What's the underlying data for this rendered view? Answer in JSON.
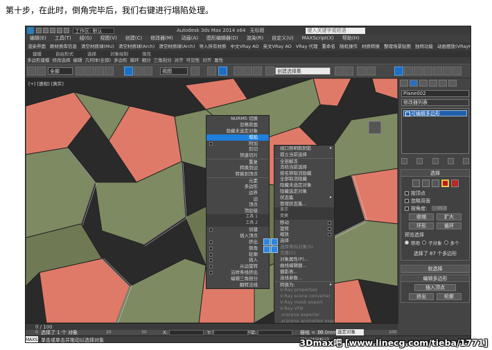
{
  "caption": "第十步，在此时，倒角完毕后，我们右键进行塌陷处理。",
  "titlebar": {
    "workspace": "工作区: 默认",
    "title": "Autodesk 3ds Max 2014 x64",
    "doc": "无标题",
    "search_placeholder": "键入关键字或短语"
  },
  "menus": [
    "编辑(E)",
    "工具(T)",
    "组(G)",
    "视图(V)",
    "创建(C)",
    "修改器(M)",
    "动画(A)",
    "图形编辑器(D)",
    "渲染(R)",
    "自定义(U)",
    "MAXScript(X)",
    "帮助(H)"
  ],
  "menus2": [
    "渲染界面",
    "刷材质库信息",
    "清空材质球(MU)",
    "清空材质球(Arch)",
    "清空材质球(Arch)",
    "导入所有材质",
    "中文VRay AO",
    "英文VRay AO",
    "VRay 代理",
    "重命名",
    "随机操作",
    "材质转换",
    "整理场景贴图",
    "独特功能",
    "动画摆放(VRayHM)"
  ],
  "ribbon_tabs": [
    "建模",
    "自由形式",
    "选择",
    "对象绘制",
    "填充"
  ],
  "ribbon_row": [
    "多边形建模",
    "修改选择",
    "编辑",
    "几何体(全部)",
    "多边形",
    "循环",
    "细分",
    "三角剖分",
    "对齐",
    "可见性",
    "对齐",
    "属性"
  ],
  "toolbar": {
    "filter": "全部",
    "view": "视图",
    "named_sel": "创建选择集"
  },
  "viewport": {
    "label": "[+] [透视] [真实]"
  },
  "quad_left": [
    {
      "text": "NURMS 切换",
      "dim": false
    },
    {
      "text": "忽略背面",
      "dim": false
    },
    {
      "text": "隐藏未选定对象",
      "dim": false
    },
    {
      "text": "塌陷",
      "hl": true,
      "box": false
    },
    {
      "text": "附加",
      "box": true
    },
    {
      "text": "剪切",
      "dim": false
    },
    {
      "text": "快速切片",
      "dim": false
    },
    {
      "text": "重复",
      "sep": true
    },
    {
      "text": "转换到边",
      "dim": false
    },
    {
      "text": "转换到顶点",
      "dim": false
    },
    {
      "text": "元素",
      "sep": true
    },
    {
      "text": "多边形",
      "dim": false
    },
    {
      "text": "边界",
      "dim": false
    },
    {
      "text": "边",
      "dim": false
    },
    {
      "text": "顶点",
      "dim": false
    },
    {
      "text": "顶层级",
      "dim": false
    },
    {
      "text": "工具 1",
      "title": true
    },
    {
      "text": "工具 2",
      "title": true
    },
    {
      "text": "创建",
      "box": true
    },
    {
      "text": "插入顶点",
      "dim": false
    },
    {
      "text": "挤出",
      "box": true
    },
    {
      "text": "倒角",
      "box": true
    },
    {
      "text": "轮廓",
      "box": true
    },
    {
      "text": "插入",
      "box": true
    },
    {
      "text": "从边旋转",
      "box": true
    },
    {
      "text": "沿样条线挤出",
      "box": true
    },
    {
      "text": "编辑三角剖分",
      "dim": false
    },
    {
      "text": "翻转法线",
      "dim": false
    }
  ],
  "quad_right": [
    {
      "text": "视口照明和阴影",
      "arrow": true
    },
    {
      "text": "孤立当前选择"
    },
    {
      "text": "全部解冻",
      "sep": true
    },
    {
      "text": "冻结当前选择"
    },
    {
      "text": "按名称取消隐藏"
    },
    {
      "text": "全部取消隐藏"
    },
    {
      "text": "隐藏未选定对象"
    },
    {
      "text": "隐藏选定对象"
    },
    {
      "text": "状态集",
      "arrow": true
    },
    {
      "text": "管理状态集..."
    },
    {
      "text": "显示",
      "title": true
    },
    {
      "text": "变换",
      "title": true
    },
    {
      "text": "移动",
      "box": true
    },
    {
      "text": "旋转",
      "box": true
    },
    {
      "text": "缩放",
      "box": true
    },
    {
      "text": "选择"
    },
    {
      "text": "选择类似对象(S)",
      "dim": true
    },
    {
      "text": "克隆(C)",
      "dim": true
    },
    {
      "text": "对象属性(P)..."
    },
    {
      "text": "曲线编辑器..."
    },
    {
      "text": "摄影表..."
    },
    {
      "text": "连线参数..."
    },
    {
      "text": "转换为:",
      "arrow": true,
      "sep": true
    },
    {
      "text": "V-Ray properties",
      "dim": true
    },
    {
      "text": "V-Ray scene converter",
      "dim": true
    },
    {
      "text": "V-Ray mesh export",
      "dim": true
    },
    {
      "text": "V-Ray VFB",
      "dim": true
    },
    {
      "text": ".vrscene exporter",
      "dim": true
    },
    {
      "text": ".vrscene animation exporter",
      "dim": true
    }
  ],
  "cmdpanel": {
    "object_name": "Plane002",
    "modifier_list": "修改器列表",
    "stack_item": "可编辑多边形",
    "selection_title": "选择",
    "by_vertex": "按顶点",
    "ignore_back": "忽略背面",
    "by_angle": "按角度:",
    "angle_value": "45.0",
    "shrink": "收缩",
    "grow": "扩大",
    "ring": "环形",
    "loop": "循环",
    "preview_title": "预览选择",
    "off": "禁用",
    "subobj": "子对象",
    "multi": "多个",
    "status": "选择了 87 个多边形",
    "soft_title": "软选择",
    "edit_poly_title": "编辑多边形",
    "insert_vertex": "插入顶点",
    "extrude": "挤出",
    "outline": "轮廓"
  },
  "timeline": {
    "frame": "0 / 100",
    "ticks": [
      "0",
      "10",
      "20",
      "30",
      "40",
      "50",
      "60",
      "70",
      "80",
      "90",
      "100"
    ]
  },
  "status": {
    "maxscript": "MAXS.m",
    "line1": "选择了 1 个 对象",
    "line2": "单击或单击并拖动以选择对象",
    "x_label": "X:",
    "y_label": "Y:",
    "z_label": "Z:",
    "grid": "栅格 = 10.0mm",
    "add_tag": "添加时间标记",
    "select_dd": "选定对象"
  },
  "watermark": "3Dmax吧  [www.linecg.com/tieba/1771]",
  "colors": {
    "salmon": "#e07a68",
    "olive": "#7e8a62",
    "highlight": "#1e7fdc"
  }
}
